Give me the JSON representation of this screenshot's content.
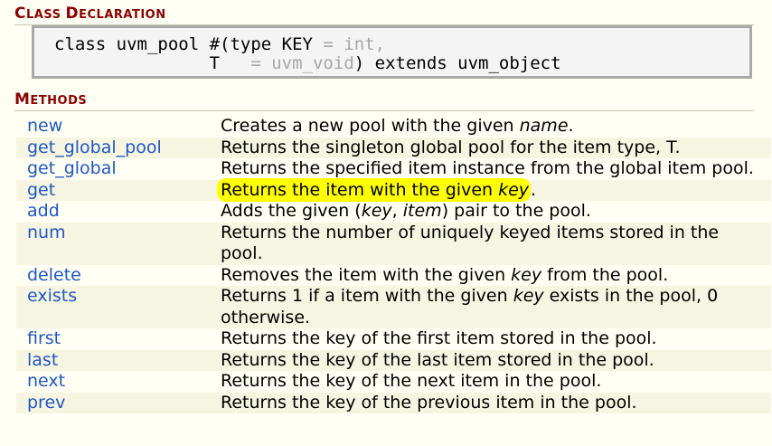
{
  "class_declaration_title": {
    "first_big": "C",
    "first_rest": "LASS ",
    "second_big": "D",
    "second_rest": "ECLARATION"
  },
  "code": {
    "line1_prefix": "class uvm_pool #(type KEY ",
    "line1_default": "= int,",
    "line2_indent": "               ",
    "line2_param": "T",
    "line2_default": "   = uvm_void",
    "line2_suffix": ") extends uvm_object"
  },
  "methods_title": {
    "first_big": "M",
    "rest": "ETHODS"
  },
  "methods": [
    {
      "name": "new",
      "desc_before": "Creates a new pool with the given ",
      "desc_italic": "name",
      "desc_after": "."
    },
    {
      "name": "get_global_pool",
      "desc": "Returns the singleton global pool for the item type, T."
    },
    {
      "name": "get_global",
      "desc": "Returns the specified item instance from the global item pool."
    },
    {
      "name": "get",
      "desc_before": "Returns the item with the given ",
      "desc_italic": "key",
      "desc_after": "."
    },
    {
      "name": "add",
      "desc_before": "Adds the given (",
      "desc_italic": "key",
      "desc_mid": ", ",
      "desc_italic2": "item",
      "desc_after": ") pair to the pool."
    },
    {
      "name": "num",
      "desc": "Returns the number of uniquely keyed items stored in the pool."
    },
    {
      "name": "delete",
      "desc_before": "Removes the item with the given ",
      "desc_italic": "key",
      "desc_after": " from the pool."
    },
    {
      "name": "exists",
      "desc_before": "Returns 1 if a item with the given ",
      "desc_italic": "key",
      "desc_after": " exists in the pool, 0 otherwise."
    },
    {
      "name": "first",
      "desc": "Returns the key of the first item stored in the pool."
    },
    {
      "name": "last",
      "desc": "Returns the key of the last item stored in the pool."
    },
    {
      "name": "next",
      "desc": "Returns the key of the next item in the pool."
    },
    {
      "name": "prev",
      "desc": "Returns the key of the previous item in the pool."
    }
  ],
  "colors": {
    "heading": "#8b0000",
    "link": "#1f57c5",
    "highlight": "#ffff00"
  }
}
